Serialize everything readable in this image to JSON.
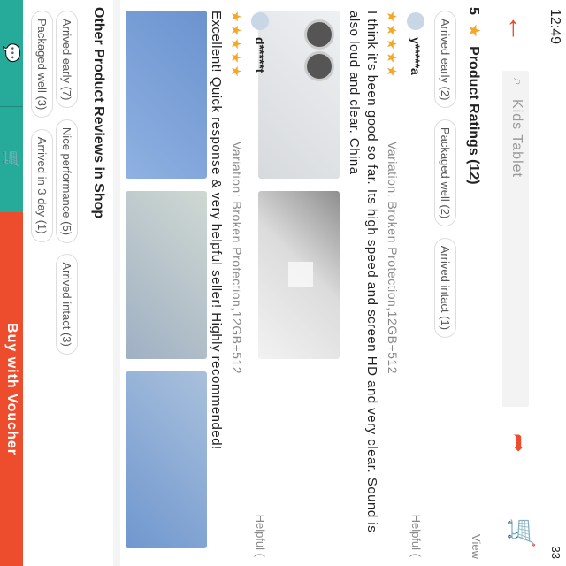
{
  "status": {
    "time": "12:49",
    "right": "33"
  },
  "header": {
    "back_icon": "arrow-left-icon",
    "search_placeholder": "Kids Tablet",
    "share_icon": "share-icon",
    "cart_icon": "cart-icon"
  },
  "ratings": {
    "score": "5",
    "title": "Product Ratings (12)",
    "view_label": "View",
    "chips": [
      "Arrived early (2)",
      "Packaged well (2)",
      "Arrived intact (1)"
    ]
  },
  "reviews": [
    {
      "user": "y*****a",
      "stars": 5,
      "helpful": "Helpful (",
      "variation": "Variation: Broken Protection,12GB+512",
      "text": "I think it's been good so far. Its high speed and screen HD and very clear. Sound is also loud and clear. China",
      "photos": 2
    },
    {
      "user": "d*****t",
      "stars": 5,
      "helpful": "Helpful (",
      "variation": "Variation: Broken Protection,12GB+512",
      "text": "Excellent! Quick response & very helpful seller! Highly recommended!",
      "photos": 3
    }
  ],
  "other_reviews": {
    "title": "Other Product Reviews in Shop",
    "chips": [
      "Arrived early (7)",
      "Nice performance (5)",
      "Arrived intact (3)",
      "Packaged well (3)",
      "Arrived in 3 day (1)"
    ]
  },
  "bottom": {
    "chat_icon": "chat-icon",
    "add_cart_icon": "add-to-cart-icon",
    "buy_label": "Buy with Voucher"
  },
  "colors": {
    "accent": "#ee4d2d",
    "teal": "#26aa99",
    "star": "#f5a623"
  }
}
